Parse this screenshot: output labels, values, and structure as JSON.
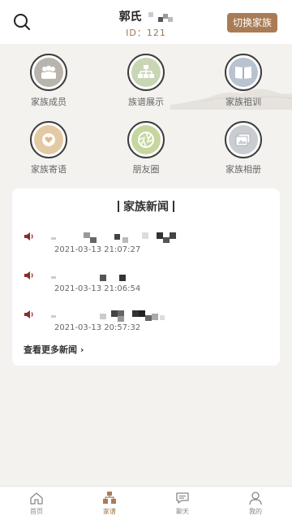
{
  "header": {
    "family_name": "郭氏",
    "family_id": "ID：121",
    "switch_label": "切换家族"
  },
  "menu": [
    {
      "label": "家族成员",
      "icon": "family-members-icon"
    },
    {
      "label": "族谱展示",
      "icon": "genealogy-tree-icon"
    },
    {
      "label": "家族祖训",
      "icon": "ancestral-book-icon"
    },
    {
      "label": "家族寄语",
      "icon": "heart-message-icon"
    },
    {
      "label": "朋友圈",
      "icon": "aperture-icon"
    },
    {
      "label": "家族相册",
      "icon": "photo-album-icon"
    }
  ],
  "news": {
    "title": "家族新闻",
    "items": [
      {
        "date": "2021-03-13 21:07:27"
      },
      {
        "date": "2021-03-13 21:06:54"
      },
      {
        "date": "2021-03-13 20:57:32"
      }
    ],
    "more_label": "查看更多新闻"
  },
  "tabs": [
    {
      "label": "首页",
      "icon": "home-icon",
      "active": false
    },
    {
      "label": "家谱",
      "icon": "family-tree-icon",
      "active": true
    },
    {
      "label": "聊天",
      "icon": "chat-icon",
      "active": false
    },
    {
      "label": "我的",
      "icon": "profile-icon",
      "active": false
    }
  ],
  "colors": {
    "accent": "#a97c55",
    "speaker": "#8b2c25"
  }
}
